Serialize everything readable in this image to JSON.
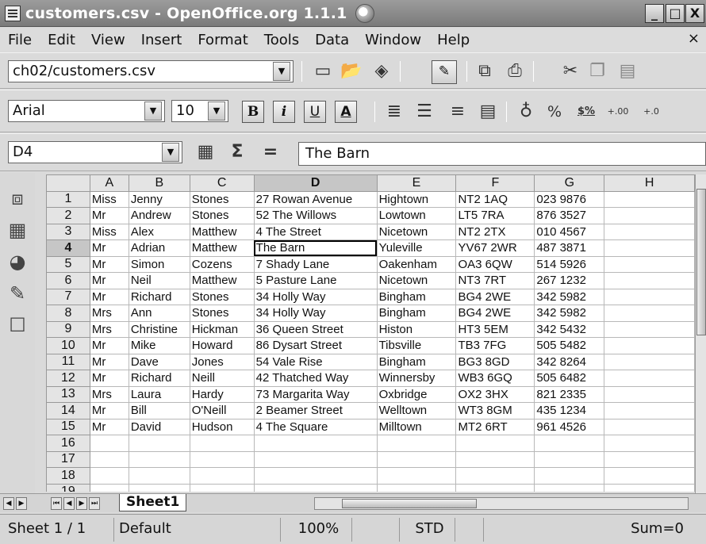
{
  "window": {
    "title": "customers.csv - OpenOffice.org 1.1.1",
    "controls": {
      "minimize": "_",
      "maximize": "□",
      "close": "X"
    }
  },
  "menubar": {
    "items": [
      "File",
      "Edit",
      "View",
      "Insert",
      "Format",
      "Tools",
      "Data",
      "Window",
      "Help"
    ],
    "close": "×"
  },
  "function_bar": {
    "url_value": "ch02/customers.csv",
    "icons": [
      "new-document-icon",
      "open-folder-icon",
      "save-icon",
      "edit-mode-icon",
      "export-pdf-icon",
      "print-icon",
      "cut-icon",
      "copy-icon",
      "paste-icon"
    ]
  },
  "object_bar": {
    "font_name": "Arial",
    "font_size": "10",
    "bold": "B",
    "italic": "i",
    "underline": "U",
    "font_color": "A",
    "percent": "%",
    "currency": "$%",
    "add_decimal": "+.00",
    "remove_decimal": "+.0"
  },
  "formula_bar": {
    "cell_ref": "D4",
    "sum_symbol": "Σ",
    "equals_symbol": "=",
    "content": "The Barn"
  },
  "sheet": {
    "columns": [
      "A",
      "B",
      "C",
      "D",
      "E",
      "F",
      "G",
      "H"
    ],
    "active_column": "D",
    "active_row": 4,
    "row_numbers": [
      1,
      2,
      3,
      4,
      5,
      6,
      7,
      8,
      9,
      10,
      11,
      12,
      13,
      14,
      15,
      16,
      17,
      18,
      19
    ],
    "rows": [
      [
        "Miss",
        "Jenny",
        "Stones",
        "27 Rowan Avenue",
        "Hightown",
        "NT2 1AQ",
        "023 9876",
        ""
      ],
      [
        "Mr",
        "Andrew",
        "Stones",
        "52 The Willows",
        "Lowtown",
        "LT5 7RA",
        "876 3527",
        ""
      ],
      [
        "Miss",
        "Alex",
        "Matthew",
        "4 The Street",
        "Nicetown",
        "NT2 2TX",
        "010 4567",
        ""
      ],
      [
        "Mr",
        "Adrian",
        "Matthew",
        "The Barn",
        "Yuleville",
        "YV67 2WR",
        "487 3871",
        ""
      ],
      [
        "Mr",
        "Simon",
        "Cozens",
        "7 Shady Lane",
        "Oakenham",
        "OA3 6QW",
        "514 5926",
        ""
      ],
      [
        "Mr",
        "Neil",
        "Matthew",
        "5 Pasture Lane",
        "Nicetown",
        "NT3 7RT",
        "267 1232",
        ""
      ],
      [
        "Mr",
        "Richard",
        "Stones",
        "34 Holly Way",
        "Bingham",
        "BG4 2WE",
        "342 5982",
        ""
      ],
      [
        "Mrs",
        "Ann",
        "Stones",
        "34 Holly Way",
        "Bingham",
        "BG4 2WE",
        "342 5982",
        ""
      ],
      [
        "Mrs",
        "Christine",
        "Hickman",
        "36 Queen Street",
        "Histon",
        "HT3 5EM",
        "342 5432",
        ""
      ],
      [
        "Mr",
        "Mike",
        "Howard",
        "86 Dysart Street",
        "Tibsville",
        "TB3 7FG",
        "505 5482",
        ""
      ],
      [
        "Mr",
        "Dave",
        "Jones",
        "54 Vale Rise",
        "Bingham",
        "BG3 8GD",
        "342 8264",
        ""
      ],
      [
        "Mr",
        "Richard",
        "Neill",
        "42 Thatched Way",
        "Winnersby",
        "WB3 6GQ",
        "505 6482",
        ""
      ],
      [
        "Mrs",
        "Laura",
        "Hardy",
        "73 Margarita Way",
        "Oxbridge",
        "OX2 3HX",
        "821 2335",
        ""
      ],
      [
        "Mr",
        "Bill",
        "O'Neill",
        "2 Beamer Street",
        "Welltown",
        "WT3 8GM",
        "435 1234",
        ""
      ],
      [
        "Mr",
        "David",
        "Hudson",
        "4 The Square",
        "Milltown",
        "MT2 6RT",
        "961 4526",
        ""
      ],
      [
        "",
        "",
        "",
        "",
        "",
        "",
        "",
        ""
      ],
      [
        "",
        "",
        "",
        "",
        "",
        "",
        "",
        ""
      ],
      [
        "",
        "",
        "",
        "",
        "",
        "",
        "",
        ""
      ],
      [
        "",
        "",
        "",
        "",
        "",
        "",
        "",
        ""
      ]
    ]
  },
  "tabs": {
    "active": "Sheet1"
  },
  "statusbar": {
    "sheet": "Sheet 1 / 1",
    "style": "Default",
    "zoom": "100%",
    "mode": "STD",
    "sum": "Sum=0"
  }
}
